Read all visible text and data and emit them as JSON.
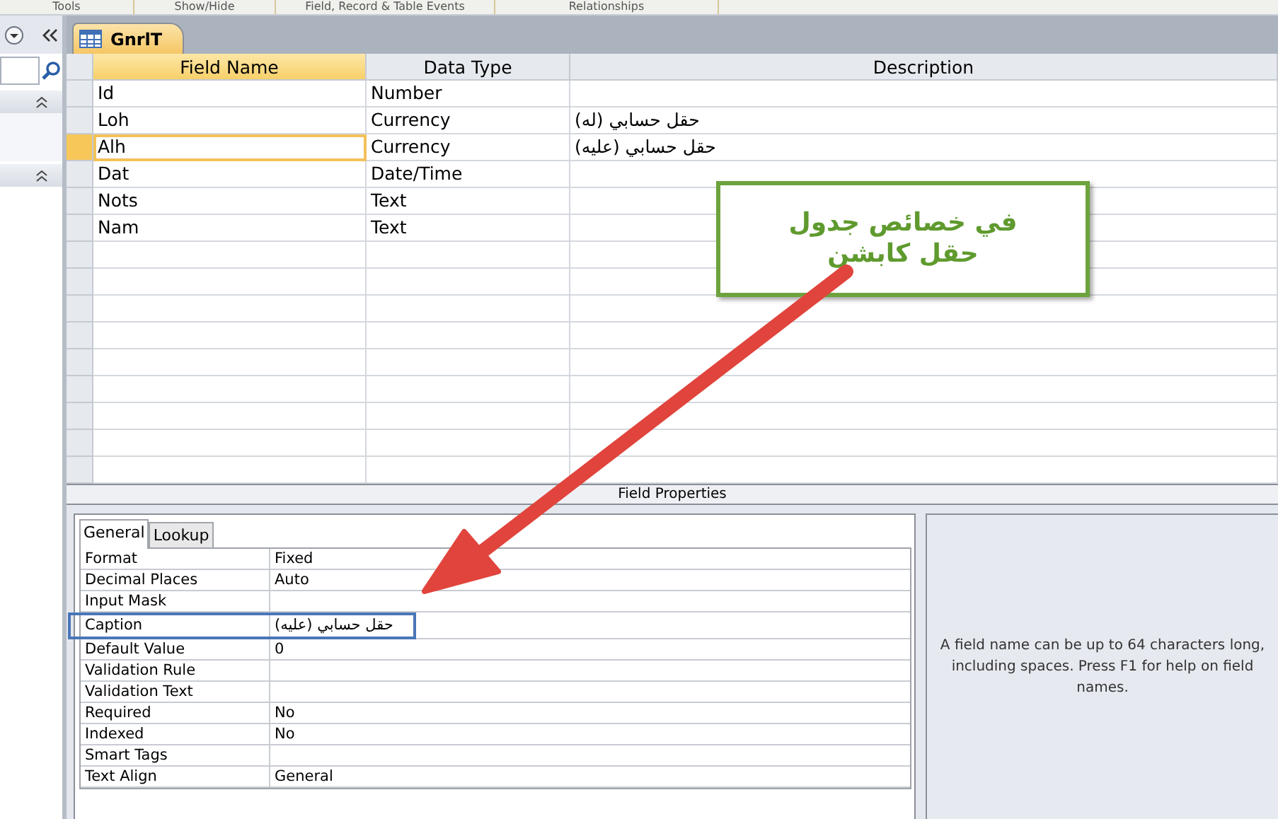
{
  "ribbon_groups": [
    "Tools",
    "Show/Hide",
    "Field, Record & Table Events",
    "Relationships"
  ],
  "document_tab": {
    "label": "GnrlT",
    "selected": true
  },
  "table": {
    "columns": [
      "Field Name",
      "Data Type",
      "Description"
    ],
    "rows": [
      {
        "field_name": "Id",
        "data_type": "Number",
        "selected": false
      },
      {
        "field_name": "Loh",
        "data_type": "Currency",
        "description": "حقل حسابي (له)",
        "selected": false
      },
      {
        "field_name": "Alh",
        "data_type": "Currency",
        "description": "حقل حسابي (عليه)",
        "selected": true
      },
      {
        "field_name": "Dat",
        "data_type": "Date/Time",
        "selected": false
      },
      {
        "field_name": "Nots",
        "data_type": "Text",
        "selected": false
      },
      {
        "field_name": "Nam",
        "data_type": "Text",
        "selected": false
      }
    ]
  },
  "field_properties": {
    "title": "Field Properties",
    "tabs": [
      {
        "label": "General",
        "selected": true
      },
      {
        "label": "Lookup",
        "selected": false
      }
    ],
    "properties": [
      {
        "name": "Format",
        "value": "Fixed",
        "highlighted": false
      },
      {
        "name": "Decimal Places",
        "value": "Auto",
        "highlighted": false
      },
      {
        "name": "Input Mask",
        "highlighted": false
      },
      {
        "name": "Caption",
        "value": "حقل حسابي (عليه)",
        "highlighted": true
      },
      {
        "name": "Default Value",
        "value": "0",
        "highlighted": false
      },
      {
        "name": "Validation Rule",
        "highlighted": false
      },
      {
        "name": "Validation Text",
        "highlighted": false
      },
      {
        "name": "Required",
        "value": "No",
        "highlighted": false
      },
      {
        "name": "Indexed",
        "value": "No",
        "highlighted": false
      },
      {
        "name": "Smart Tags",
        "highlighted": false
      },
      {
        "name": "Text Align",
        "value": "General",
        "highlighted": false
      }
    ],
    "help_text": "A field name can be up to 64 characters long, including spaces. Press F1 for help on field names."
  },
  "callout": {
    "text": "في خصائص جدول حقل كابشن"
  }
}
